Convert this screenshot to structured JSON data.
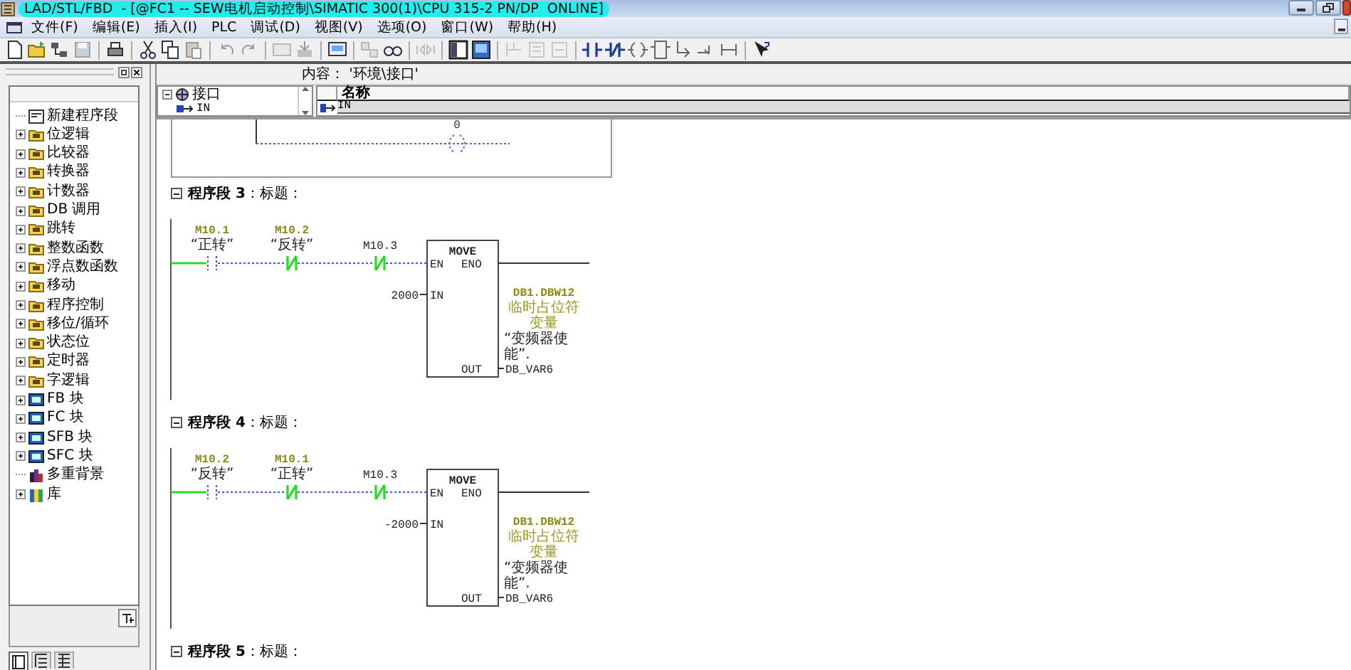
{
  "window": {
    "title": "LAD/STL/FBD  - [@FC1 -- SEW电机启动控制\\SIMATIC 300(1)\\CPU 315-2 PN/DP  ONLINE]"
  },
  "menu": [
    "文件(F)",
    "编辑(E)",
    "插入(I)",
    "PLC",
    "调试(D)",
    "视图(V)",
    "选项(O)",
    "窗口(W)",
    "帮助(H)"
  ],
  "elements_panel": {
    "items": [
      {
        "label": "新建程序段",
        "kind": "leaf"
      },
      {
        "label": "位逻辑",
        "kind": "folder",
        "expanded": false
      },
      {
        "label": "比较器",
        "kind": "folder",
        "expanded": false
      },
      {
        "label": "转换器",
        "kind": "folder",
        "expanded": false
      },
      {
        "label": "计数器",
        "kind": "folder",
        "expanded": false
      },
      {
        "label": "DB 调用",
        "kind": "folder",
        "expanded": false
      },
      {
        "label": "跳转",
        "kind": "folder",
        "expanded": false
      },
      {
        "label": "整数函数",
        "kind": "folder",
        "expanded": false
      },
      {
        "label": "浮点数函数",
        "kind": "folder",
        "expanded": false
      },
      {
        "label": "移动",
        "kind": "folder",
        "expanded": false
      },
      {
        "label": "程序控制",
        "kind": "folder",
        "expanded": false
      },
      {
        "label": "移位/循环",
        "kind": "folder",
        "expanded": false
      },
      {
        "label": "状态位",
        "kind": "folder",
        "expanded": false
      },
      {
        "label": "定时器",
        "kind": "folder",
        "expanded": false
      },
      {
        "label": "字逻辑",
        "kind": "folder",
        "expanded": false
      },
      {
        "label": "FB 块",
        "kind": "block",
        "expanded": false
      },
      {
        "label": "FC 块",
        "kind": "block",
        "expanded": false
      },
      {
        "label": "SFB 块",
        "kind": "block",
        "expanded": false
      },
      {
        "label": "SFC 块",
        "kind": "block",
        "expanded": false
      },
      {
        "label": "多重背景",
        "kind": "multi"
      },
      {
        "label": "库",
        "kind": "library",
        "expanded": false
      }
    ],
    "view_tabs": [
      {
        "selected": true
      },
      {
        "selected": false
      },
      {
        "selected": false
      }
    ]
  },
  "interface": {
    "content_label": "内容： '环境\\接口'",
    "tree": [
      {
        "label": "接口",
        "expanded": true,
        "children": [
          {
            "label": "IN"
          }
        ]
      }
    ],
    "table": {
      "columns": [
        "名称"
      ],
      "rows": [
        [
          "IN"
        ]
      ]
    }
  },
  "partial_network": {
    "value": "0"
  },
  "networks": [
    {
      "header": "**程序段 3**：标题：",
      "expanded": true,
      "contacts": [
        {
          "kind": "no",
          "address": "M10.1",
          "symbol": "“正转”",
          "energized": false
        },
        {
          "kind": "nc",
          "address": "M10.2",
          "symbol": "“反转”",
          "energized": true
        },
        {
          "kind": "nc",
          "address": "M10.3",
          "energized": true
        }
      ],
      "block": {
        "title": "MOVE",
        "en": "EN",
        "eno": "ENO",
        "in_pin": "IN",
        "out_pin": "OUT",
        "in_value": "2000",
        "out_address": "DB1.DBW12",
        "out_comment_lines": [
          "临时占位符",
          "变量"
        ],
        "out_symbol_lines": [
          "“变频器使",
          "能”."
        ],
        "out_name": "DB_VAR6"
      }
    },
    {
      "header": "**程序段 4**：标题：",
      "expanded": true,
      "contacts": [
        {
          "kind": "no",
          "address": "M10.2",
          "symbol": "“反转”",
          "energized": false
        },
        {
          "kind": "nc",
          "address": "M10.1",
          "symbol": "“正转”",
          "energized": true
        },
        {
          "kind": "nc",
          "address": "M10.3",
          "energized": true
        }
      ],
      "block": {
        "title": "MOVE",
        "en": "EN",
        "eno": "ENO",
        "in_pin": "IN",
        "out_pin": "OUT",
        "in_value": "-2000",
        "out_address": "DB1.DBW12",
        "out_comment_lines": [
          "临时占位符",
          "变量"
        ],
        "out_symbol_lines": [
          "“变频器使",
          "能”."
        ],
        "out_name": "DB_VAR6"
      }
    },
    {
      "header": "**程序段 5**：标题：",
      "expanded": true
    }
  ]
}
